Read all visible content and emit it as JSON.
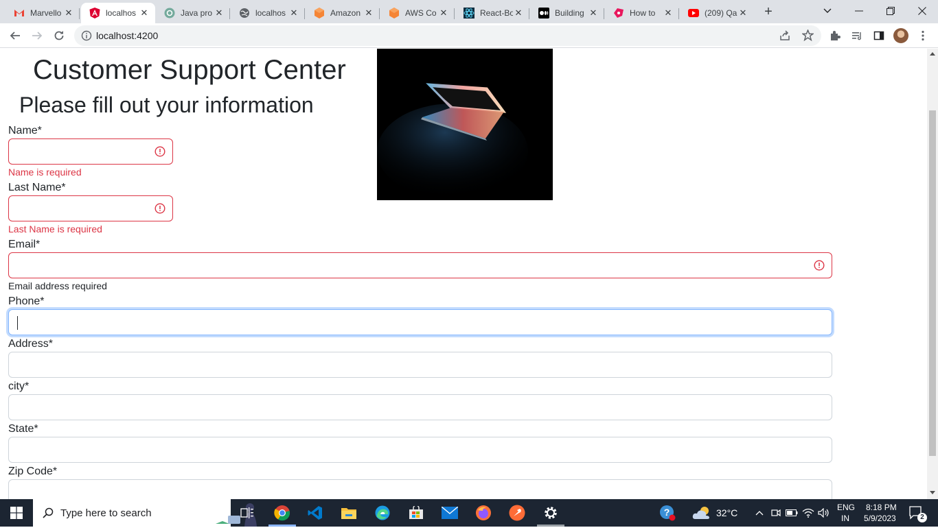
{
  "browser": {
    "tabs": [
      {
        "title": "Marvello",
        "icon": "gmail-icon"
      },
      {
        "title": "localhos",
        "icon": "angular-icon"
      },
      {
        "title": "Java pro",
        "icon": "chatgpt-icon"
      },
      {
        "title": "localhos",
        "icon": "globe-icon"
      },
      {
        "title": "Amazon",
        "icon": "aws-icon"
      },
      {
        "title": "AWS Co",
        "icon": "aws-icon"
      },
      {
        "title": "React-Bo",
        "icon": "react-icon"
      },
      {
        "title": "Building",
        "icon": "medium-icon"
      },
      {
        "title": "How to",
        "icon": "hashnode-icon"
      },
      {
        "title": "(209) Qa",
        "icon": "youtube-icon"
      }
    ],
    "active_tab": 1,
    "url": "localhost:4200"
  },
  "page": {
    "title": "Customer Support Center",
    "subtitle": "Please fill out your information",
    "fields": {
      "name": {
        "label": "Name*",
        "value": "",
        "error": "Name is required"
      },
      "last_name": {
        "label": "Last Name*",
        "value": "",
        "error": "Last Name is required"
      },
      "email": {
        "label": "Email*",
        "value": "",
        "hint": "Email address required"
      },
      "phone": {
        "label": "Phone*",
        "value": ""
      },
      "address": {
        "label": "Address*",
        "value": ""
      },
      "city": {
        "label": "city*",
        "value": ""
      },
      "state": {
        "label": "State*",
        "value": ""
      },
      "zip": {
        "label": "Zip Code*",
        "value": ""
      }
    }
  },
  "taskbar": {
    "search_placeholder": "Type here to search",
    "weather": "32°C",
    "lang_top": "ENG",
    "lang_bottom": "IN",
    "time": "8:18 PM",
    "date": "5/9/2023",
    "notifications": "2"
  },
  "colors": {
    "error": "#dc3545",
    "focus": "#86b7fe",
    "taskbar": "#1c2532"
  }
}
